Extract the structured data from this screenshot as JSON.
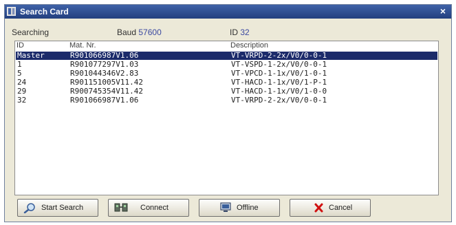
{
  "window": {
    "title": "Search Card",
    "close_glyph": "×"
  },
  "status": {
    "searching_label": "Searching",
    "baud_label": "Baud",
    "baud_value": "57600",
    "id_label": "ID",
    "id_value": "32"
  },
  "table": {
    "columns": [
      "ID",
      "Mat. Nr.",
      "Description"
    ],
    "rows": [
      {
        "id": "Master",
        "mat": "R901066987V1.06",
        "desc": "VT-VRPD-2-2x/V0/0-0-1",
        "selected": true
      },
      {
        "id": "1",
        "mat": "R901077297V1.03",
        "desc": "VT-VSPD-1-2x/V0/0-0-1",
        "selected": false
      },
      {
        "id": "5",
        "mat": "R901044346V2.83",
        "desc": "VT-VPCD-1-1x/V0/1-0-1",
        "selected": false
      },
      {
        "id": "24",
        "mat": "R901151005V11.42",
        "desc": "VT-HACD-1-1x/V0/1-P-1",
        "selected": false
      },
      {
        "id": "29",
        "mat": "R900745354V11.42",
        "desc": "VT-HACD-1-1x/V0/1-0-0",
        "selected": false
      },
      {
        "id": "32",
        "mat": "R901066987V1.06",
        "desc": "VT-VRPD-2-2x/V0/0-0-1",
        "selected": false
      }
    ]
  },
  "buttons": {
    "start_search": "Start Search",
    "connect": "Connect",
    "offline": "Offline",
    "cancel": "Cancel"
  },
  "colors": {
    "selection": "#1b2a6a",
    "value_text": "#3a48a0",
    "cancel_icon": "#d01010"
  },
  "icons": {
    "title": "app-icon",
    "start_search": "magnifier-icon",
    "connect": "connect-icon",
    "offline": "monitor-icon",
    "cancel": "x-icon"
  }
}
